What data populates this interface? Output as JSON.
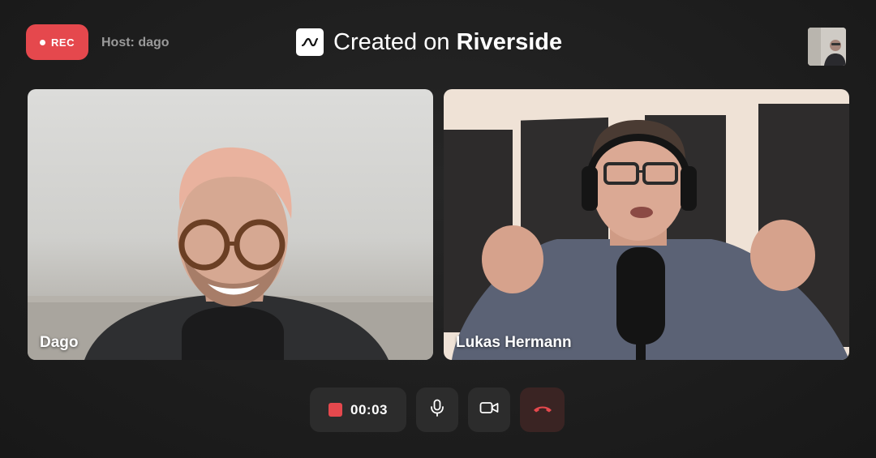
{
  "header": {
    "rec_label": "REC",
    "host_label": "Host: dago",
    "brand_prefix": "Created on",
    "brand_name": "Riverside",
    "logo_icon": "riverside-wave-icon"
  },
  "participants": [
    {
      "name": "Dago"
    },
    {
      "name": "Lukas Hermann"
    }
  ],
  "controls": {
    "timer": "00:03",
    "mic_icon": "microphone-icon",
    "camera_icon": "video-camera-icon",
    "end_icon": "hang-up-phone-icon"
  },
  "colors": {
    "background": "#1c1c1c",
    "rec_red": "#e5484d",
    "control_bg": "#2c2c2c",
    "end_call_red": "#e5484d"
  }
}
